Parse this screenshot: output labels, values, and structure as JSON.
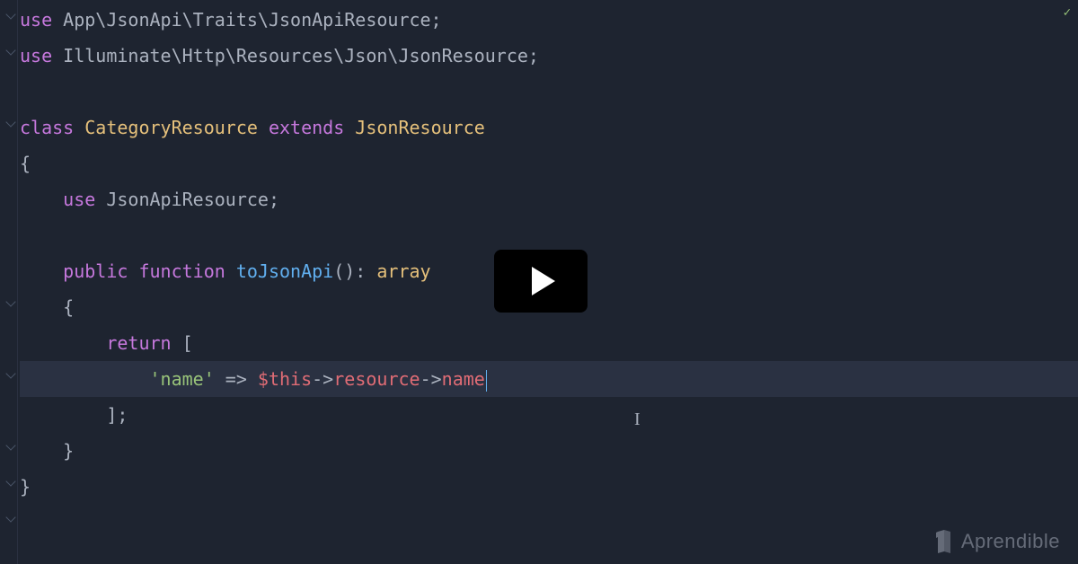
{
  "code": {
    "line1": {
      "use": "use",
      "ns": " App\\JsonApi\\Traits\\JsonApiResource;"
    },
    "line2": {
      "use": "use",
      "ns": " Illuminate\\Http\\Resources\\Json\\JsonResource;"
    },
    "line4": {
      "class": "class",
      "name": " CategoryResource ",
      "extends": "extends",
      "parent": " JsonResource"
    },
    "line5": {
      "brace": "{"
    },
    "line6": {
      "indent": "    ",
      "use": "use",
      "trait": " JsonApiResource;"
    },
    "line8": {
      "indent": "    ",
      "public": "public",
      "function": " function ",
      "funcname": "toJsonApi",
      "parens": "(): ",
      "type": "array"
    },
    "line9": {
      "indent": "    ",
      "brace": "{"
    },
    "line10": {
      "indent": "        ",
      "return": "return",
      "bracket": " ["
    },
    "line11": {
      "indent": "            ",
      "key": "'name'",
      "arrow": " => ",
      "dollar": "$",
      "this": "this",
      "arr1": "->",
      "prop1": "resource",
      "arr2": "->",
      "prop2": "name"
    },
    "line12": {
      "indent": "        ",
      "bracket": "];"
    },
    "line13": {
      "indent": "    ",
      "brace": "}"
    },
    "line14": {
      "brace": "}"
    }
  },
  "logo": {
    "text": "Aprendible"
  },
  "cursor_char": "I"
}
